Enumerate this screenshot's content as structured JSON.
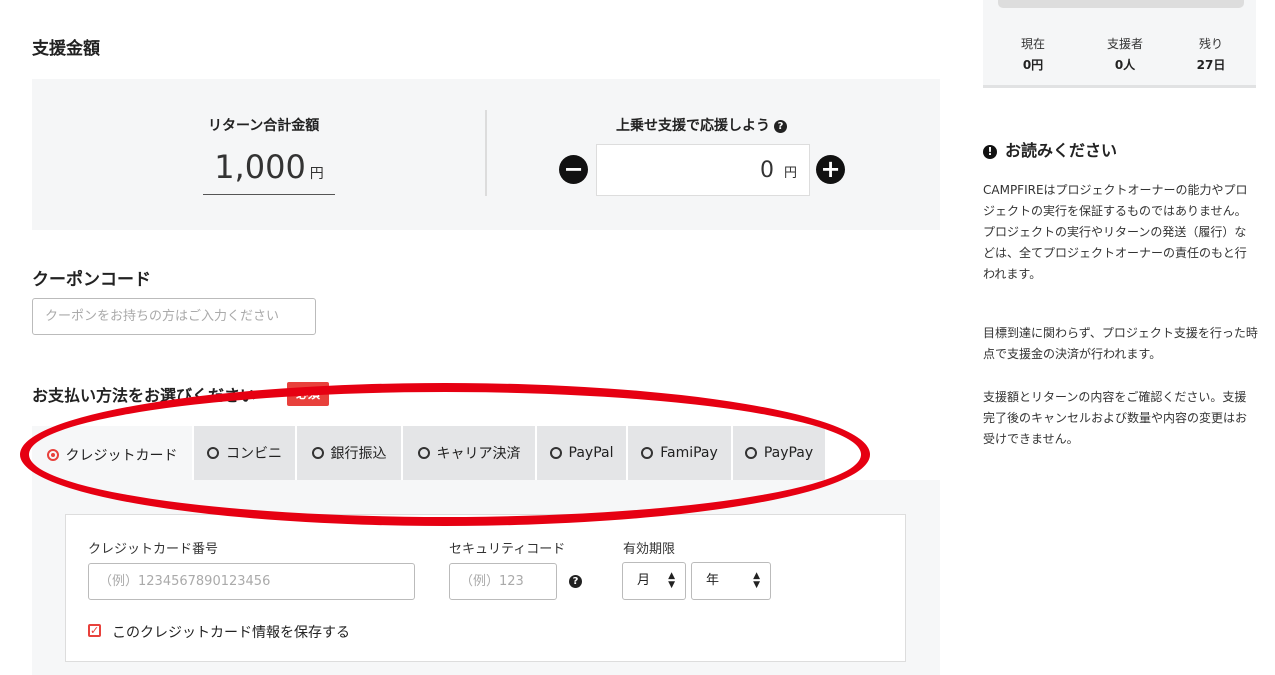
{
  "support_amount": {
    "section_title": "支援金額",
    "return_total_label": "リターン合計金額",
    "return_total_value": "1,000",
    "yen": "円",
    "extra_label": "上乗せ支援で応援しよう",
    "extra_value": "0",
    "minus_symbol": "−",
    "plus_symbol": "+"
  },
  "coupon": {
    "section_title": "クーポンコード",
    "placeholder": "クーポンをお持ちの方はご入力ください"
  },
  "payment": {
    "section_title": "お支払い方法をお選びください",
    "required_badge": "必須",
    "selected_index": 0,
    "tabs": [
      {
        "label": "クレジットカード"
      },
      {
        "label": "コンビニ"
      },
      {
        "label": "銀行振込"
      },
      {
        "label": "キャリア決済"
      },
      {
        "label": "PayPal"
      },
      {
        "label": "FamiPay"
      },
      {
        "label": "PayPay"
      }
    ],
    "card_form": {
      "card_number_label": "クレジットカード番号",
      "card_number_placeholder": "（例）1234567890123456",
      "security_code_label": "セキュリティコード",
      "security_code_placeholder": "（例）123",
      "expiry_label": "有効期限",
      "month_value": "月",
      "year_value": "年",
      "save_card_label": "このクレジットカード情報を保存する",
      "save_card_checked": true
    }
  },
  "project_stats": {
    "items": [
      {
        "label": "現在",
        "value": "0円"
      },
      {
        "label": "支援者",
        "value": "0人"
      },
      {
        "label": "残り",
        "value": "27日"
      }
    ]
  },
  "notice": {
    "title": "お読みください",
    "paragraphs": [
      "CAMPFIREはプロジェクトオーナーの能力やプロジェクトの実行を保証するものではありません。プロジェクトの実行やリターンの発送（履行）などは、全てプロジェクトオーナーの責任のもと行われます。",
      "目標到達に関わらず、プロジェクト支援を行った時点で支援金の決済が行われます。",
      "支援額とリターンの内容をご確認ください。支援完了後のキャンセルおよび数量や内容の変更はお受けできません。"
    ]
  },
  "colors": {
    "accent": "#e8413c",
    "annotation_red": "#e60012",
    "panel_bg": "#f5f6f7",
    "tab_bg": "#e4e5e7"
  }
}
